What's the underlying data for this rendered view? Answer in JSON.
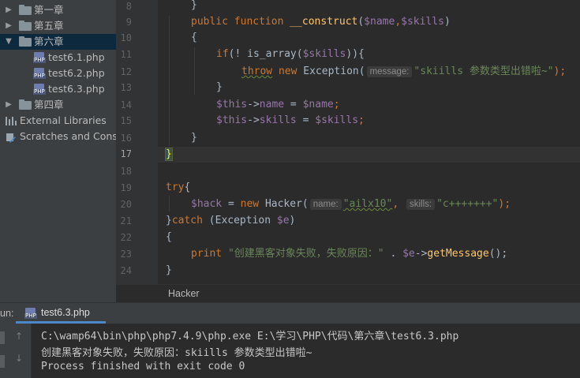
{
  "project_tree": {
    "items": [
      {
        "label": "第一章",
        "type": "folder",
        "expanded": false
      },
      {
        "label": "第五章",
        "type": "folder",
        "expanded": false
      },
      {
        "label": "第六章",
        "type": "folder",
        "expanded": true,
        "selected": true
      },
      {
        "label": "test6.1.php",
        "type": "php"
      },
      {
        "label": "test6.2.php",
        "type": "php"
      },
      {
        "label": "test6.3.php",
        "type": "php"
      },
      {
        "label": "第四章",
        "type": "folder",
        "expanded": false
      },
      {
        "label": "External Libraries",
        "type": "libraries"
      },
      {
        "label": "Scratches and Conso",
        "type": "scratches"
      }
    ]
  },
  "editor": {
    "line_numbers": [
      "8",
      "9",
      "10",
      "11",
      "12",
      "13",
      "14",
      "15",
      "16",
      "17",
      "18",
      "19",
      "20",
      "21",
      "22",
      "23",
      "24"
    ],
    "current_line": "17",
    "lines": [
      [
        "}"
      ],
      [
        "public",
        "function",
        "__construct",
        "(",
        "$name",
        ",",
        "$skills",
        ")"
      ],
      [
        "{"
      ],
      [
        "if",
        "(! ",
        "is_array",
        "(",
        "$skills",
        ")){"
      ],
      [
        "throw",
        "new",
        "Exception(",
        "message:",
        "\"skiills 参数类型出错啦~\"",
        ");"
      ],
      [
        "}"
      ],
      [
        "$this",
        "->",
        "name",
        " = ",
        "$name",
        ";"
      ],
      [
        "$this",
        "->",
        "skills",
        " = ",
        "$skills",
        ";"
      ],
      [
        "}"
      ],
      [
        "}"
      ],
      [
        ""
      ],
      [
        "try",
        "{"
      ],
      [
        "$hack",
        " = ",
        "new",
        "Hacker(",
        "name:",
        "\"ailx10\"",
        ", ",
        "skills:",
        "\"c+++++++\"",
        ");"
      ],
      [
        "}",
        "catch",
        " (Exception ",
        "$e",
        ")"
      ],
      [
        "{"
      ],
      [
        "print",
        "\"创建黑客对象失败，失败原因：\"",
        " . ",
        "$e",
        "->",
        "getMessage",
        "();"
      ],
      [
        "}"
      ]
    ]
  },
  "breadcrumb": {
    "label": "Hacker"
  },
  "run_panel": {
    "label": "un:",
    "tab_label": "test6.3.php",
    "output": [
      "C:\\wamp64\\bin\\php\\php7.4.9\\php.exe E:\\学习\\PHP\\代码\\第六章\\test6.3.php",
      "创建黑客对象失败，失败原因：skiills 参数类型出错啦~",
      "Process finished with exit code 0"
    ]
  },
  "colors": {
    "keyword": "#cc7832",
    "function": "#ffc66d",
    "variable": "#9876aa",
    "string": "#6a8759",
    "text": "#a9b7c6",
    "selection": "#0d293e",
    "tab_accent": "#4a88c7"
  }
}
